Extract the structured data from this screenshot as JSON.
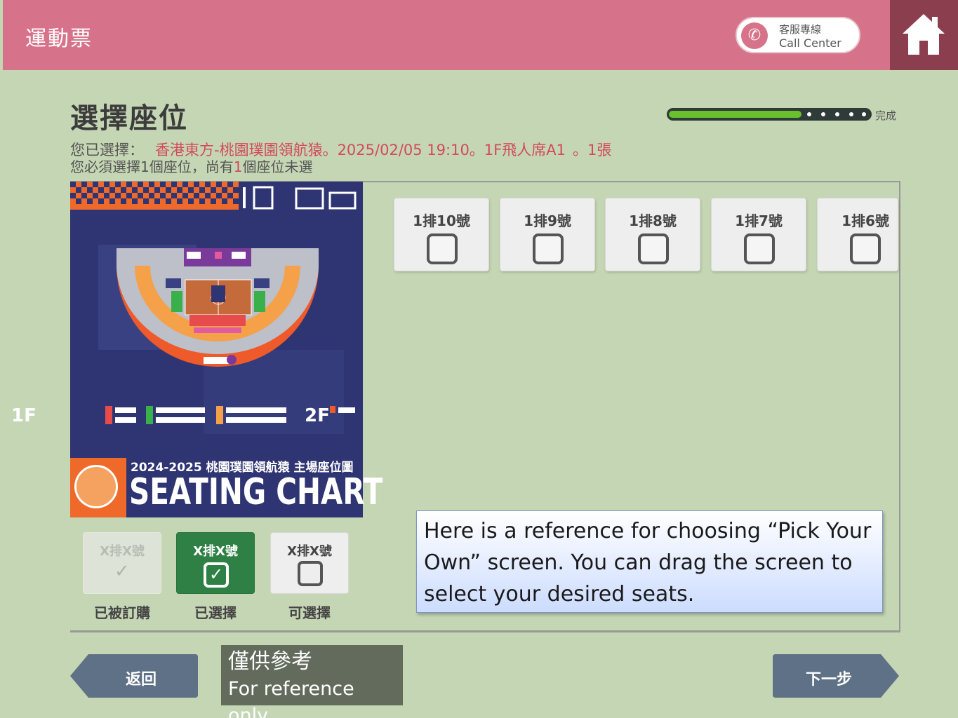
{
  "header": {
    "app_title": "運動票",
    "call_center_line1": "客服專線",
    "call_center_line2": "Call Center",
    "home_icon": "home-icon",
    "phone_icon": "phone-icon",
    "background": "#d6738a"
  },
  "page": {
    "title": "選擇座位",
    "progress_label": "完成",
    "progress_fraction": 0.66,
    "selection_prefix": "您已選擇：",
    "selection_value": "香港東方-桃園璞園領航猿。2025/02/05 19:10。1F飛人席A1",
    "selection_qty": "。1張",
    "requirement_prefix": "您必須選擇1個座位，尚有",
    "requirement_count": "1",
    "requirement_suffix": "個座位未選"
  },
  "seat_map": {
    "floor_1": "1F",
    "floor_2": "2F",
    "subtitle": "2024-2025 桃園璞園領航猿 主場座位圖",
    "title": "SEATING CHART"
  },
  "seats": [
    {
      "label": "1排10號"
    },
    {
      "label": "1排9號"
    },
    {
      "label": "1排8號"
    },
    {
      "label": "1排7號"
    },
    {
      "label": "1排6號"
    }
  ],
  "legend": {
    "booked": {
      "label": "X排X號",
      "caption": "已被訂購"
    },
    "selected": {
      "label": "X排X號",
      "caption": "已選擇"
    },
    "available": {
      "label": "X排X號",
      "caption": "可選擇"
    }
  },
  "annotation": "Here is a reference for choosing “Pick Your Own”  screen. You can drag the screen to select your desired seats.",
  "reference_note": {
    "line1": "僅供參考",
    "line2": "For reference only"
  },
  "nav": {
    "back_label": "返回",
    "next_label": "下一步"
  }
}
